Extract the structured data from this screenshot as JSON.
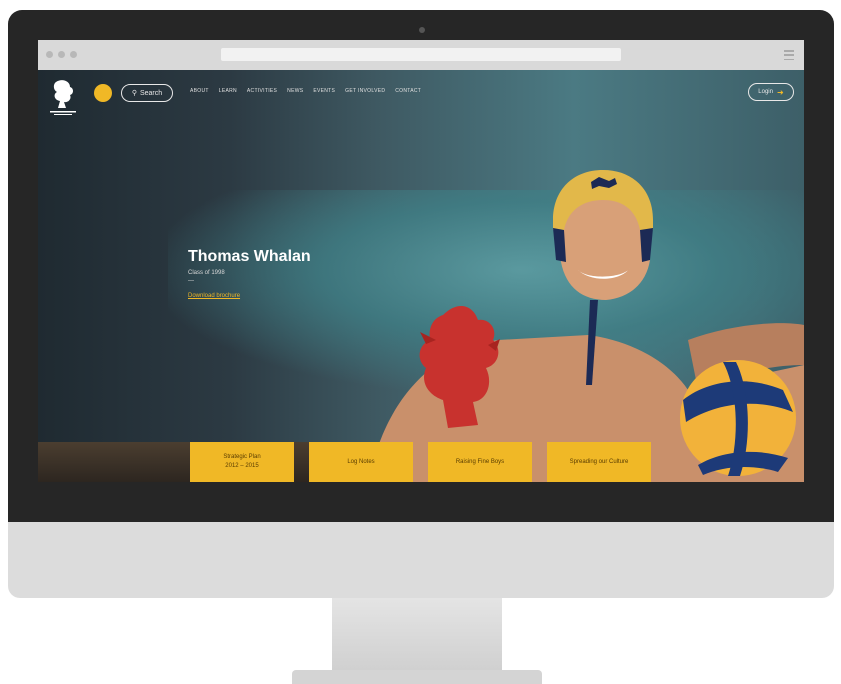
{
  "site": {
    "search_label": "Search",
    "nav": [
      "ABOUT",
      "LEARN",
      "ACTIVITIES",
      "NEWS",
      "EVENTS",
      "GET INVOLVED",
      "CONTACT"
    ],
    "login_label": "Login"
  },
  "hero": {
    "name": "Thomas Whalan",
    "subtitle": "Class of 1998",
    "dash": "—",
    "link": "Download brochure"
  },
  "cards": [
    {
      "line1": "Strategic Plan",
      "line2": "2012 – 2015"
    },
    {
      "line1": "Log Notes",
      "line2": ""
    },
    {
      "line1": "Raising Fine Boys",
      "line2": ""
    },
    {
      "line1": "Spreading our Culture",
      "line2": ""
    }
  ],
  "colors": {
    "accent": "#f0b826",
    "bezel": "#262626",
    "chin": "#dcdcdc",
    "hero_overlay": "#1f2a31"
  },
  "icons": {
    "logo": "lion-crest-icon",
    "search": "magnifier-icon",
    "login": "arrow-right-icon",
    "menu": "hamburger-icon"
  }
}
